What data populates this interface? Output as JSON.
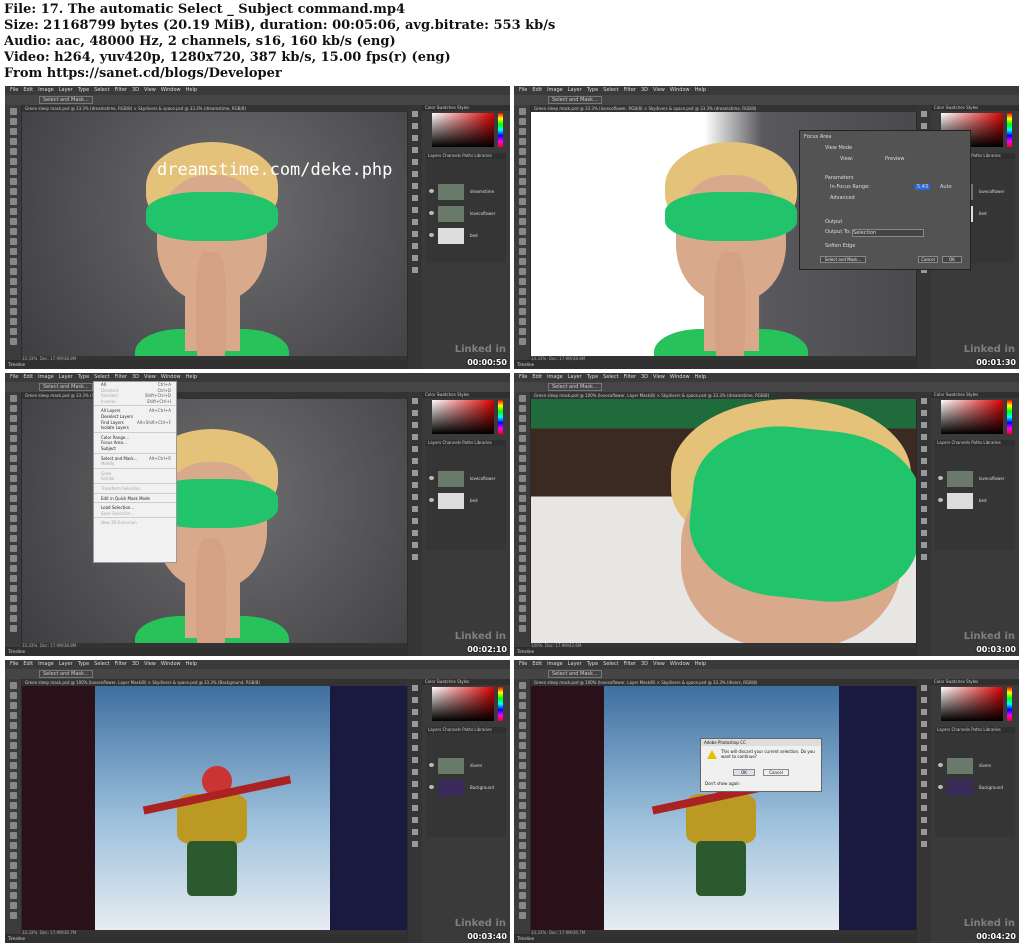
{
  "file_info": {
    "file": "File: 17. The automatic Select _ Subject command.mp4",
    "size": "Size: 21168799 bytes (20.19 MiB), duration: 00:05:06, avg.bitrate: 553 kb/s",
    "audio": "Audio: aac, 48000 Hz, 2 channels, s16, 160 kb/s (eng)",
    "video": "Video: h264, yuv420p, 1280x720, 387 kb/s, 15.00 fps(r) (eng)",
    "from": "From https://sanet.cd/blogs/Developer"
  },
  "menu_items": [
    "File",
    "Edit",
    "Image",
    "Layer",
    "Type",
    "Select",
    "Filter",
    "3D",
    "View",
    "Window",
    "Help"
  ],
  "linkedin": "Linked in",
  "panels": [
    {
      "timecode": "00:00:50",
      "tab": "Green sleep mask.psd @ 33.3% (dreamstime, RGB/8) ×   Skydivers & space.psd @ 33.3% (dreamstime, RGB/8)",
      "zoom": "33.33%",
      "doc": "Doc: 17.9M/38.8M",
      "watermark": "dreamstime.com/deke.php",
      "layers": [
        "dreamstime",
        "lovecoflower",
        "bed"
      ],
      "button": "Select and Mask..."
    },
    {
      "timecode": "00:01:30",
      "tab": "Green sleep mask.psd @ 33.3% (lovecoflower, RGB/8) ×   Skydivers & space.psd @ 33.3% (dreamstime, RGB/8)",
      "zoom": "33.33%",
      "doc": "Doc: 17.9M/38.8M",
      "layers": [
        "lovecoflower",
        "bed"
      ],
      "dialog": {
        "title": "Focus Area",
        "view_mode": "View Mode",
        "view": "View:",
        "preview": "Preview",
        "parameters": "Parameters",
        "range": "In-Focus Range:",
        "range_val": "5.43",
        "auto": "Auto",
        "advanced": "Advanced",
        "output": "Output",
        "output_to": "Output To:",
        "output_val": "Selection",
        "soften": "Soften Edge",
        "select_mask": "Select and Mask...",
        "cancel": "Cancel",
        "ok": "OK"
      }
    },
    {
      "timecode": "00:02:10",
      "tab": "Green sleep mask.psd @ 33.3% (lovecoflower, RGB/8)",
      "zoom": "33.33%",
      "doc": "Doc: 17.9M/38.8M",
      "layers": [
        "lovecoflower",
        "bed"
      ],
      "menu": [
        [
          "All",
          "Ctrl+A",
          0
        ],
        [
          "Deselect",
          "Ctrl+D",
          1
        ],
        [
          "Reselect",
          "Shift+Ctrl+D",
          1
        ],
        [
          "Inverse",
          "Shift+Ctrl+I",
          1
        ],
        [
          "-",
          "",
          0
        ],
        [
          "All Layers",
          "Alt+Ctrl+A",
          0
        ],
        [
          "Deselect Layers",
          "",
          0
        ],
        [
          "Find Layers",
          "Alt+Shift+Ctrl+F",
          0
        ],
        [
          "Isolate Layers",
          "",
          0
        ],
        [
          "-",
          "",
          0
        ],
        [
          "Color Range...",
          "",
          0
        ],
        [
          "Focus Area...",
          "",
          0
        ],
        [
          "Subject",
          "",
          0
        ],
        [
          "-",
          "",
          0
        ],
        [
          "Select and Mask...",
          "Alt+Ctrl+R",
          0
        ],
        [
          "Modify",
          "",
          1
        ],
        [
          "-",
          "",
          0
        ],
        [
          "Grow",
          "",
          1
        ],
        [
          "Similar",
          "",
          1
        ],
        [
          "-",
          "",
          0
        ],
        [
          "Transform Selection",
          "",
          1
        ],
        [
          "-",
          "",
          0
        ],
        [
          "Edit in Quick Mask Mode",
          "",
          0
        ],
        [
          "-",
          "",
          0
        ],
        [
          "Load Selection...",
          "",
          0
        ],
        [
          "Save Selection...",
          "",
          1
        ],
        [
          "-",
          "",
          0
        ],
        [
          "New 3D Extrusion",
          "",
          1
        ]
      ]
    },
    {
      "timecode": "00:03:00",
      "tab": "Green sleep mask.psd @ 100% (lovecoflower, Layer Mask/8) ×   Skydivers & space.psd @ 33.3% (dreamstime, RGB/8)",
      "zoom": "100%",
      "doc": "Doc: 17.9M/42.6M",
      "layers": [
        "lovecoflower",
        "bed"
      ]
    },
    {
      "timecode": "00:03:40",
      "tab": "Green sleep mask.psd @ 100% (lovecoflower, Layer Mask/8) ×   Skydivers & space.psd @ 33.3% (Background, RGB/8)",
      "zoom": "33.33%",
      "doc": "Doc: 17.9M/36.7M",
      "layers": [
        "divers",
        "Background"
      ]
    },
    {
      "timecode": "00:04:20",
      "tab": "Green sleep mask.psd @ 100% (lovecoflower, Layer Mask/8) ×   Skydivers & space.psd @ 33.3% (divers, RGB/8)",
      "zoom": "33.33%",
      "doc": "Doc: 17.9M/36.7M",
      "layers": [
        "divers",
        "Background"
      ],
      "alert": {
        "title": "Adobe Photoshop CC",
        "message": "This will discard your current selection. Do you want to continue?",
        "ok": "OK",
        "cancel": "Cancel",
        "checkbox": "Don't show again"
      }
    }
  ],
  "panel_tabs": "Color   Swatches   Styles",
  "layers_tabs": "Layers   Channels   Paths   Libraries",
  "timeline": "Timeline"
}
